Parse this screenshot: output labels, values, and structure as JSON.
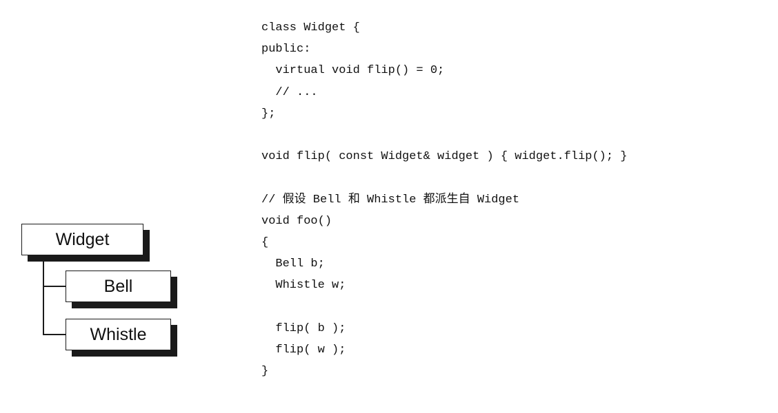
{
  "diagram": {
    "base_class": "Widget",
    "derived_classes": [
      "Bell",
      "Whistle"
    ]
  },
  "code": {
    "lines": [
      "class Widget {",
      "public:",
      "  virtual void flip() = 0;",
      "  // ...",
      "};",
      "",
      "void flip( const Widget& widget ) { widget.flip(); }",
      "",
      "// 假设 Bell 和 Whistle 都派生自 Widget",
      "void foo()",
      "{",
      "  Bell b;",
      "  Whistle w;",
      "",
      "  flip( b );",
      "  flip( w );",
      "}"
    ]
  }
}
